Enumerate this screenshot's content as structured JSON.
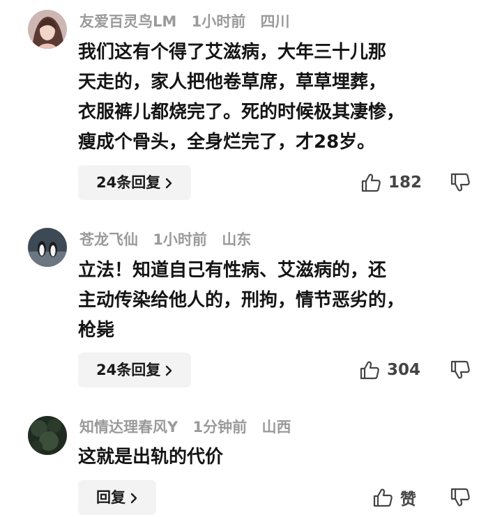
{
  "comments": [
    {
      "username": "友爱百灵鸟LM",
      "time": "1小时前",
      "location": "四川",
      "text": "我们这有个得了艾滋病，大年三十儿那\n天走的，家人把他卷草席，草草埋葬，\n衣服裤儿都烧完了。死的时候极其凄惨，\n瘦成个骨头，全身烂完了，才28岁。",
      "reply_label": "24条回复",
      "likes": "182",
      "avatar_icon": "woman-portrait-avatar"
    },
    {
      "username": "苍龙飞仙",
      "time": "1小时前",
      "location": "山东",
      "text": "立法！知道自己有性病、艾滋病的，还\n主动传染给他人的，刑拘，情节恶劣的，\n枪毙",
      "reply_label": "24条回复",
      "likes": "304",
      "avatar_icon": "penguins-avatar"
    },
    {
      "username": "知情达理春风Y",
      "time": "1分钟前",
      "location": "山西",
      "text": "这就是出轨的代价",
      "reply_label": "回复",
      "likes": "赞",
      "avatar_icon": "dark-foliage-avatar"
    }
  ],
  "colors": {
    "meta": "#9a9a9a",
    "text": "#141414",
    "button_bg": "#f3f3f3",
    "icon": "#444444"
  }
}
